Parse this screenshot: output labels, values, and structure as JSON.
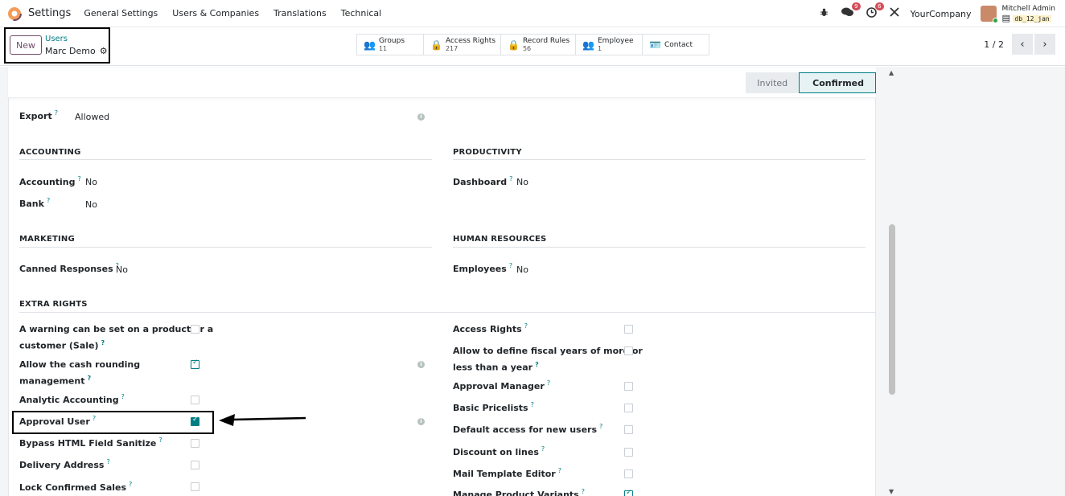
{
  "nav": {
    "app_title": "Settings",
    "menu": [
      "General Settings",
      "Users & Companies",
      "Translations",
      "Technical"
    ],
    "chat_badge": "9",
    "activity_badge": "6",
    "company": "YourCompany",
    "user_name": "Mitchell Admin",
    "db_name": "db_12_jan"
  },
  "control": {
    "new_label": "New",
    "breadcrumb_parent": "Users",
    "record_name": "Marc Demo",
    "stats": [
      {
        "label": "Groups",
        "value": "11",
        "icon": "users-icon"
      },
      {
        "label": "Access Rights",
        "value": "217",
        "icon": "lock-icon"
      },
      {
        "label": "Record Rules",
        "value": "56",
        "icon": "lock-icon"
      },
      {
        "label": "Employee",
        "value": "1",
        "icon": "users-icon"
      },
      {
        "label": "Contact",
        "value": "",
        "icon": "id-card-icon"
      }
    ],
    "pager": "1 / 2"
  },
  "status": {
    "invited": "Invited",
    "confirmed": "Confirmed"
  },
  "form": {
    "export_label": "Export",
    "export_value": "Allowed",
    "accounting_title": "ACCOUNTING",
    "accounting_label": "Accounting",
    "accounting_value": "No",
    "bank_label": "Bank",
    "bank_value": "No",
    "productivity_title": "PRODUCTIVITY",
    "dashboard_label": "Dashboard",
    "dashboard_value": "No",
    "marketing_title": "MARKETING",
    "canned_label": "Canned Responses",
    "canned_value": "No",
    "hr_title": "HUMAN RESOURCES",
    "employees_label": "Employees",
    "employees_value": "No",
    "extra_title": "EXTRA RIGHTS",
    "left_rights": [
      {
        "label": "A warning can be set on a product or a",
        "label2": "customer (Sale)",
        "checked": false
      },
      {
        "label": "Allow the cash rounding",
        "label2": "management",
        "checked": true
      },
      {
        "label": "Analytic Accounting",
        "checked": false
      },
      {
        "label": "Approval User",
        "checked": true
      },
      {
        "label": "Bypass HTML Field Sanitize",
        "checked": false
      },
      {
        "label": "Delivery Address",
        "checked": false
      },
      {
        "label": "Lock Confirmed Sales",
        "checked": false
      }
    ],
    "right_rights": [
      {
        "label": "Access Rights",
        "checked": false
      },
      {
        "label": "Allow to define fiscal years of more or",
        "label2": "less than a year",
        "checked": false
      },
      {
        "label": "Approval Manager",
        "checked": false
      },
      {
        "label": "Basic Pricelists",
        "checked": false
      },
      {
        "label": "Default access for new users",
        "checked": false
      },
      {
        "label": "Discount on lines",
        "checked": false
      },
      {
        "label": "Mail Template Editor",
        "checked": false
      },
      {
        "label": "Manage Product Variants",
        "checked": true
      }
    ]
  },
  "colors": {
    "accent": "#017e84",
    "brand": "#714b67",
    "badge": "#d44c59"
  }
}
